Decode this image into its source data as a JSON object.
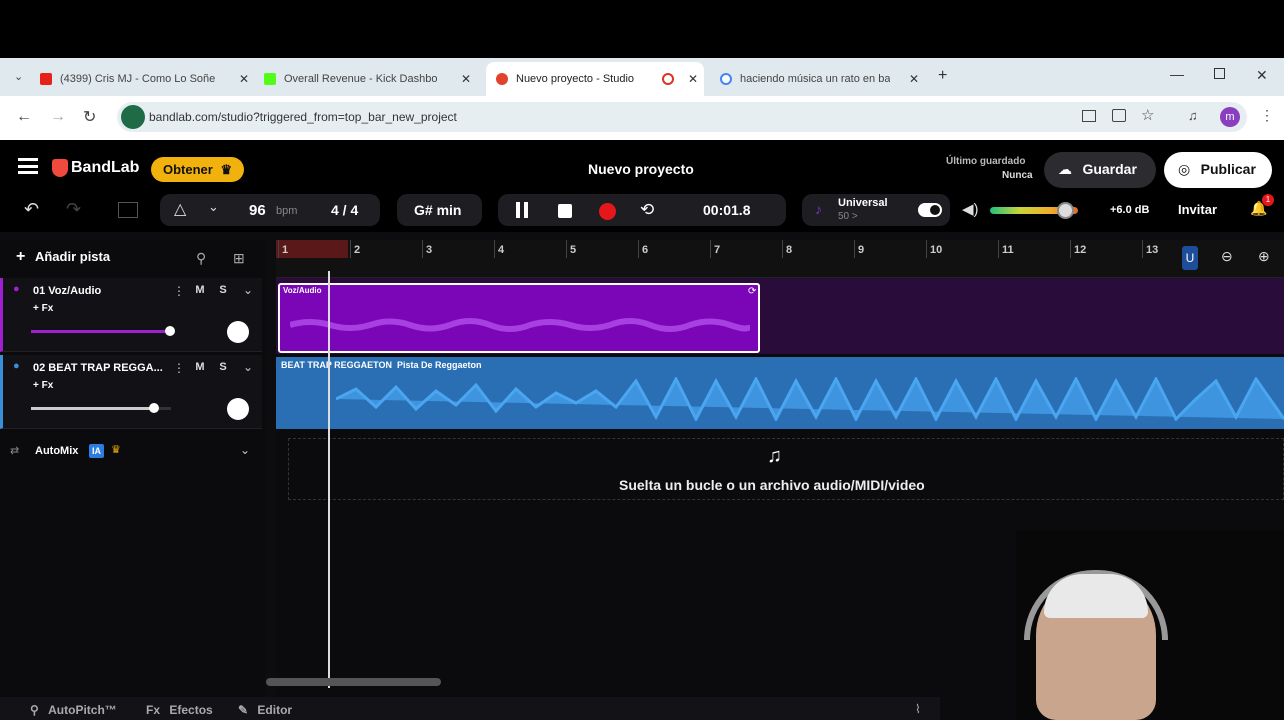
{
  "browser": {
    "tabs": [
      {
        "label": "(4399) Cris MJ - Como Lo Soñe",
        "icon": "youtube-icon",
        "color": "#e62117"
      },
      {
        "label": "Overall Revenue - Kick Dashbo",
        "icon": "kick-icon",
        "color": "#53fc18"
      },
      {
        "label": "Nuevo proyecto - Studio",
        "icon": "bandlab-icon",
        "color": "#e2412b"
      },
      {
        "label": "haciendo música un rato en ba",
        "icon": "google-icon",
        "color": "#4285f4"
      }
    ],
    "url": "bandlab.com/studio?triggered_from=top_bar_new_project",
    "profile_initial": "m"
  },
  "app": {
    "brand": "BandLab",
    "obtener": "Obtener",
    "project_title": "Nuevo proyecto",
    "last_saved_label": "Último guardado",
    "last_saved_value": "Nunca",
    "guardar": "Guardar",
    "publicar": "Publicar"
  },
  "controls": {
    "bpm_value": "96",
    "bpm_unit": "bpm",
    "time_signature": "4 / 4",
    "key": "G# min",
    "time": "00:01.8",
    "universal_label": "Universal",
    "universal_value": "50 >",
    "volume_db": "+6.0 dB",
    "invitar": "Invitar",
    "notifications_badge": "1",
    "volume_level": 0.85
  },
  "sidebar": {
    "add_track": "Añadir pista",
    "tracks": [
      {
        "name": "01  Voz/Audio",
        "fx": "+ Fx",
        "mute": "M",
        "solo": "S",
        "color": "#a020d0",
        "volume": 0.99
      },
      {
        "name": "02  BEAT TRAP REGGA...",
        "fx": "+ Fx",
        "mute": "M",
        "solo": "S",
        "color": "#3a8fd8",
        "volume": 0.88
      }
    ],
    "automix_label": "AutoMix",
    "automix_badge": "IA"
  },
  "timeline": {
    "bars": [
      "1",
      "2",
      "3",
      "4",
      "5",
      "6",
      "7",
      "8",
      "9",
      "10",
      "11",
      "12",
      "13"
    ],
    "clip1_label": "Voz/Audio",
    "clip2_label": "BEAT TRAP REGGAETON  Pista De Reggaeton",
    "drop_text": "Suelta un bucle o un archivo audio/MIDI/video"
  },
  "bottom": {
    "autopitch": "AutoPitch™",
    "efectos": "Efectos",
    "editor": "Editor"
  }
}
